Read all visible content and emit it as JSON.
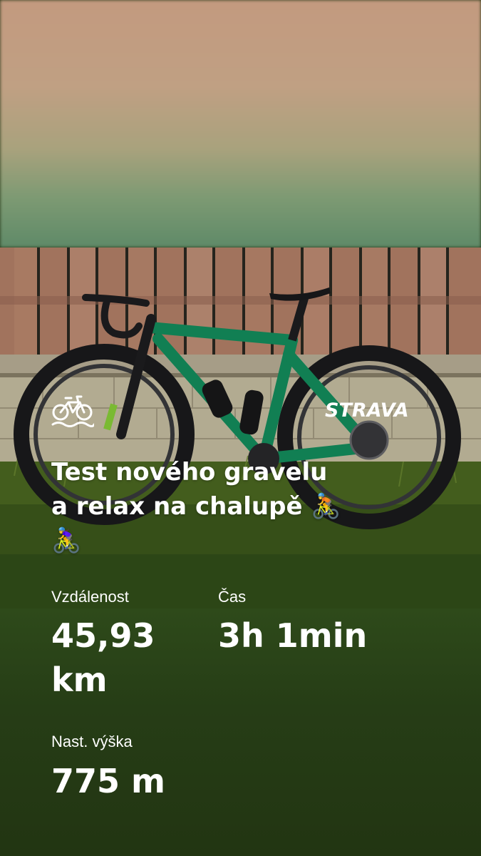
{
  "activity": {
    "title_line1": "Test nového gravelu",
    "title_line2": "a relax na chalupě 🚴",
    "title_line3": "🚴‍♀️",
    "activity_icon": "bike-ride-icon"
  },
  "brand": {
    "logo_text": "STRAVA"
  },
  "stats": {
    "distance_label": "Vzdálenost",
    "distance_value_line1": "45,93",
    "distance_value_line2": "km",
    "time_label": "Čas",
    "time_value": "3h 1min",
    "elevation_label": "Nast. výška",
    "elevation_value": "775 m"
  },
  "colors": {
    "text": "#ffffff",
    "bike_frame": "#14915f",
    "bottom_bg": "#263d16"
  }
}
